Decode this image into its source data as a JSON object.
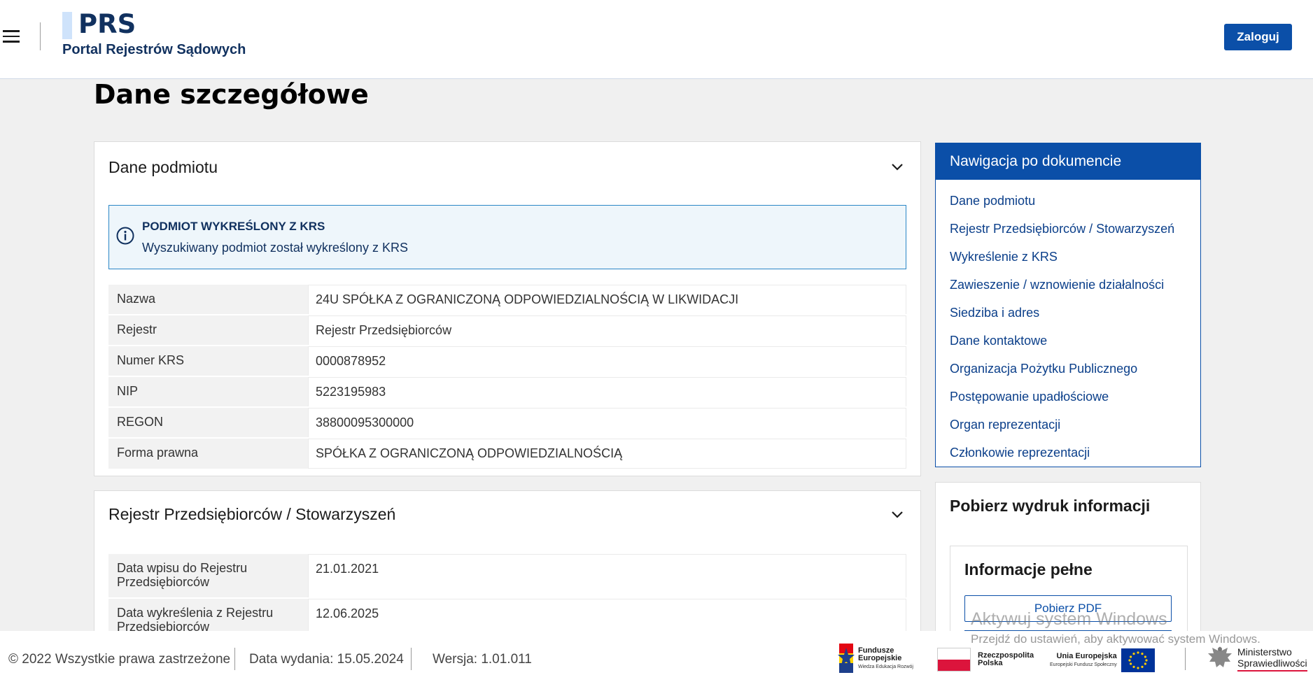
{
  "header": {
    "logo_title": "PRS",
    "logo_subtitle": "Portal Rejestrów Sądowych",
    "login_label": "Zaloguj"
  },
  "page_title": "Dane szczegółowe",
  "entity_section": {
    "title": "Dane podmiotu",
    "alert_title": "PODMIOT WYKREŚLONY Z KRS",
    "alert_text": "Wyszukiwany podmiot został wykreślony z KRS",
    "rows": [
      {
        "label": "Nazwa",
        "value": "24U SPÓŁKA Z OGRANICZONĄ ODPOWIEDZIALNOŚCIĄ W LIKWIDACJI"
      },
      {
        "label": "Rejestr",
        "value": "Rejestr Przedsiębiorców"
      },
      {
        "label": "Numer KRS",
        "value": "0000878952"
      },
      {
        "label": "NIP",
        "value": "5223195983"
      },
      {
        "label": "REGON",
        "value": "38800095300000"
      },
      {
        "label": "Forma prawna",
        "value": "SPÓŁKA Z OGRANICZONĄ ODPOWIEDZIALNOŚCIĄ"
      }
    ]
  },
  "register_section": {
    "title": "Rejestr Przedsiębiorców / Stowarzyszeń",
    "rows": [
      {
        "label": "Data wpisu do Rejestru Przedsiębiorców",
        "value": "21.01.2021"
      },
      {
        "label": "Data wykreślenia z Rejestru Przedsiębiorców",
        "value": "12.06.2025"
      }
    ]
  },
  "nav_panel": {
    "title": "Nawigacja po dokumencie",
    "items": [
      "Dane podmiotu",
      "Rejestr Przedsiębiorców / Stowarzyszeń",
      "Wykreślenie z KRS",
      "Zawieszenie / wznowienie działalności",
      "Siedziba i adres",
      "Dane kontaktowe",
      "Organizacja Pożytku Publicznego",
      "Postępowanie upadłościowe",
      "Organ reprezentacji",
      "Członkowie reprezentacji"
    ]
  },
  "print_panel": {
    "title": "Pobierz wydruk informacji",
    "subtitle": "Informacje pełne",
    "pdf_label": "Pobierz PDF"
  },
  "watermark": {
    "line1": "Aktywuj system Windows",
    "line2": "Przejdź do ustawień, aby aktywować system Windows."
  },
  "footer": {
    "copyright": "© 2022 Wszystkie prawa zastrzeżone",
    "release": "Data wydania: 15.05.2024",
    "version": "Wersja: 1.01.011",
    "logos": {
      "fe_line1": "Fundusze",
      "fe_line2": "Europejskie",
      "fe_small": "Wiedza Edukacja Rozwój",
      "rp_line1": "Rzeczpospolita",
      "rp_line2": "Polska",
      "ue_line1": "Unia Europejska",
      "ue_small": "Europejski Fundusz Społeczny",
      "ms_line1": "Ministerstwo",
      "ms_line2": "Sprawiedliwości"
    }
  },
  "colors": {
    "primary": "#0b4fa8",
    "brand_dark": "#11315f",
    "alert_border": "#2a86c6",
    "background": "#f0f0f0"
  }
}
